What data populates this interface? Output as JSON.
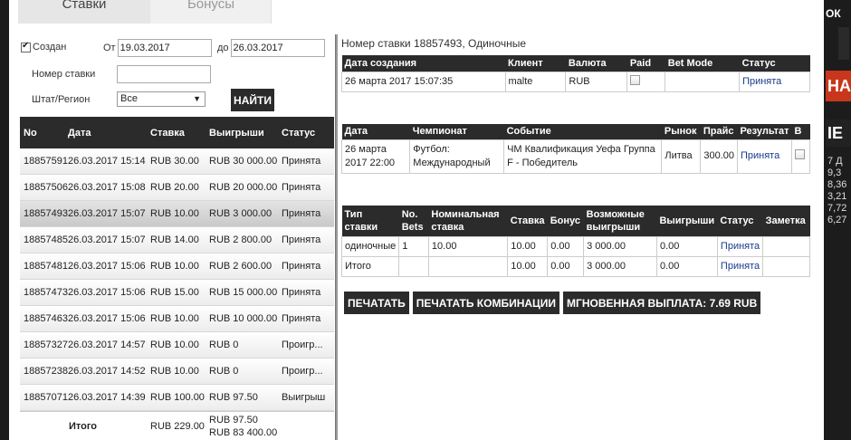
{
  "background": {
    "ok_label": "ОК",
    "banner_1": "НА",
    "banner_2": "IE",
    "side_numbers": [
      "7 Д",
      "9,3",
      "8,36",
      "3,21",
      "7,72",
      "6,27"
    ]
  },
  "tabs": [
    {
      "label": "Ставки",
      "active": true
    },
    {
      "label": "Бонусы",
      "active": false
    }
  ],
  "filters": {
    "created_label": "Создан",
    "created_checked": true,
    "from_label": "От",
    "from_value": "19.03.2017",
    "to_label": "до",
    "to_value": "26.03.2017",
    "bet_number_label": "Номер ставки",
    "bet_number_value": "",
    "region_label": "Штат/Регион",
    "region_value": "Все",
    "search_button": "НАЙТИ"
  },
  "bets_table": {
    "headers": [
      "No",
      "Дата",
      "Ставка",
      "Выигрыши",
      "Статус"
    ],
    "rows": [
      {
        "no": "18857591",
        "date": "26.03.2017 15:14",
        "stake": "RUB 30.00",
        "win": "RUB 30 000.00",
        "status": "Принята"
      },
      {
        "no": "18857506",
        "date": "26.03.2017 15:08",
        "stake": "RUB 20.00",
        "win": "RUB 20 000.00",
        "status": "Принята"
      },
      {
        "no": "18857493",
        "date": "26.03.2017 15:07",
        "stake": "RUB 10.00",
        "win": "RUB 3 000.00",
        "status": "Принята"
      },
      {
        "no": "18857485",
        "date": "26.03.2017 15:07",
        "stake": "RUB 14.00",
        "win": "RUB 2 800.00",
        "status": "Принята"
      },
      {
        "no": "18857481",
        "date": "26.03.2017 15:06",
        "stake": "RUB 10.00",
        "win": "RUB 2 600.00",
        "status": "Принята"
      },
      {
        "no": "18857473",
        "date": "26.03.2017 15:06",
        "stake": "RUB 15.00",
        "win": "RUB 15 000.00",
        "status": "Принята"
      },
      {
        "no": "18857463",
        "date": "26.03.2017 15:06",
        "stake": "RUB 10.00",
        "win": "RUB 10 000.00",
        "status": "Принята"
      },
      {
        "no": "18857327",
        "date": "26.03.2017 14:57",
        "stake": "RUB 10.00",
        "win": "RUB 0",
        "status": "Проигр..."
      },
      {
        "no": "18857238",
        "date": "26.03.2017 14:52",
        "stake": "RUB 10.00",
        "win": "RUB 0",
        "status": "Проигр..."
      },
      {
        "no": "18857071",
        "date": "26.03.2017 14:39",
        "stake": "RUB 100.00",
        "win": "RUB 97.50",
        "status": "Выигрыш"
      }
    ],
    "selected_index": 2,
    "total": {
      "label": "Итого",
      "stake": "RUB 229.00",
      "win_1": "RUB 97.50",
      "win_2": "RUB 83 400.00"
    }
  },
  "detail": {
    "title": "Номер ставки 18857493, Одиночные",
    "info_headers": [
      "Дата создания",
      "Клиент",
      "Валюта",
      "Paid",
      "Bet Mode",
      "Статус"
    ],
    "info_row": {
      "created": "26 марта 2017 15:07:35",
      "client": "malte",
      "currency": "RUB",
      "bet_mode": "",
      "status": "Принята"
    },
    "event_headers": [
      "Дата",
      "Чемпионат",
      "Событие",
      "Рынок",
      "Прайс",
      "Результат",
      "В"
    ],
    "event_row": {
      "date_1": "26 марта",
      "date_2": "2017 22:00",
      "championship_1": "Футбол:",
      "championship_2": "Международный",
      "event_1": "ЧМ Квалификация Уефа Группа",
      "event_2": "F - Победитель",
      "market": "Литва",
      "price": "300.00",
      "result": "Принята"
    },
    "summary_headers": {
      "type_1": "Тип",
      "type_2": "ставки",
      "bets_1": "No.",
      "bets_2": "Bets",
      "nominal_1": "Номинальная",
      "nominal_2": "ставка",
      "stake": "Ставка",
      "bonus": "Бонус",
      "possible_1": "Возможные",
      "possible_2": "выигрыши",
      "wins": "Выигрыши",
      "status": "Статус",
      "note": "Заметка"
    },
    "summary_rows": [
      {
        "type": "одиночные",
        "bets": "1",
        "nominal": "10.00",
        "stake": "10.00",
        "bonus": "0.00",
        "possible": "3 000.00",
        "wins": "0.00",
        "status": "Принята",
        "note": ""
      },
      {
        "type": "Итого",
        "bets": "",
        "nominal": "",
        "stake": "10.00",
        "bonus": "0.00",
        "possible": "3 000.00",
        "wins": "0.00",
        "status": "Принята",
        "note": ""
      }
    ],
    "buttons": {
      "print": "ПЕЧАТАТЬ",
      "print_combinations": "ПЕЧАТАТЬ КОМБИНАЦИИ",
      "instant_payout": "МГНОВЕННАЯ ВЫПЛАТА: 7.69 RUB"
    }
  }
}
